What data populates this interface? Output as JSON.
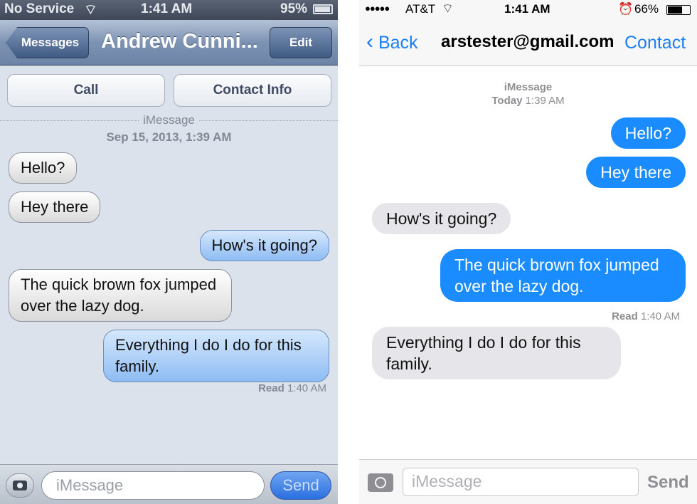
{
  "ios6": {
    "status": {
      "carrier": "No Service",
      "time": "1:41 AM",
      "battery": "95%",
      "battery_level": 0.95
    },
    "nav": {
      "back": "Messages",
      "title": "Andrew Cunni...",
      "edit": "Edit"
    },
    "actions": {
      "call": "Call",
      "contact_info": "Contact Info"
    },
    "service": "iMessage",
    "date": "Sep 15, 2013, 1:39 AM",
    "messages": [
      {
        "dir": "in",
        "text": "Hello?"
      },
      {
        "dir": "in",
        "text": "Hey there"
      },
      {
        "dir": "out",
        "text": "How's it going?"
      },
      {
        "dir": "in",
        "text": "The quick brown fox jumped over the lazy dog."
      },
      {
        "dir": "out",
        "text": "Everything I do I do for this family."
      }
    ],
    "read_label": "Read",
    "read_time": "1:40 AM",
    "input": {
      "placeholder": "iMessage",
      "send": "Send"
    }
  },
  "ios7": {
    "status": {
      "signal": "●●●●●",
      "carrier": "AT&T",
      "time": "1:41 AM",
      "battery": "66%",
      "battery_level": 0.66
    },
    "nav": {
      "back": "Back",
      "title": "arstester@gmail.com",
      "contact": "Contact"
    },
    "service": "iMessage",
    "date_day": "Today",
    "date_time": "1:39 AM",
    "messages": [
      {
        "dir": "out",
        "text": "Hello?"
      },
      {
        "dir": "out",
        "text": "Hey there"
      },
      {
        "dir": "in",
        "text": "How's it going?"
      },
      {
        "dir": "out",
        "text": "The quick brown fox jumped over the lazy dog."
      },
      {
        "dir": "in",
        "text": "Everything I do I do for this family."
      }
    ],
    "read_label": "Read",
    "read_time": "1:40 AM",
    "input": {
      "placeholder": "iMessage",
      "send": "Send"
    }
  },
  "colors": {
    "ios7_blue": "#1a8cff",
    "ios7_gray": "#e5e5ea",
    "ios6_nav": "#6b83a6"
  }
}
